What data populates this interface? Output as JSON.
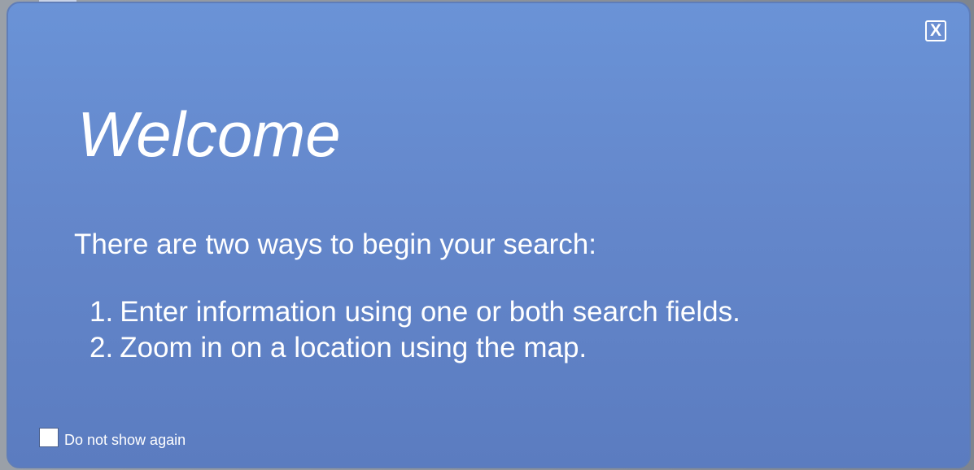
{
  "dialog": {
    "close_label": "X",
    "title": "Welcome",
    "intro": "There are two ways to begin your search:",
    "steps": [
      {
        "number": "1.",
        "text": "Enter information using one or both search fields."
      },
      {
        "number": "2.",
        "text": "Zoom in on a location using the map."
      }
    ],
    "dont_show_label": "Do not show again",
    "dont_show_checked": false
  },
  "colors": {
    "dialog_top": "#6a93d7",
    "dialog_bottom": "#5b7cc0",
    "text": "#ffffff"
  }
}
